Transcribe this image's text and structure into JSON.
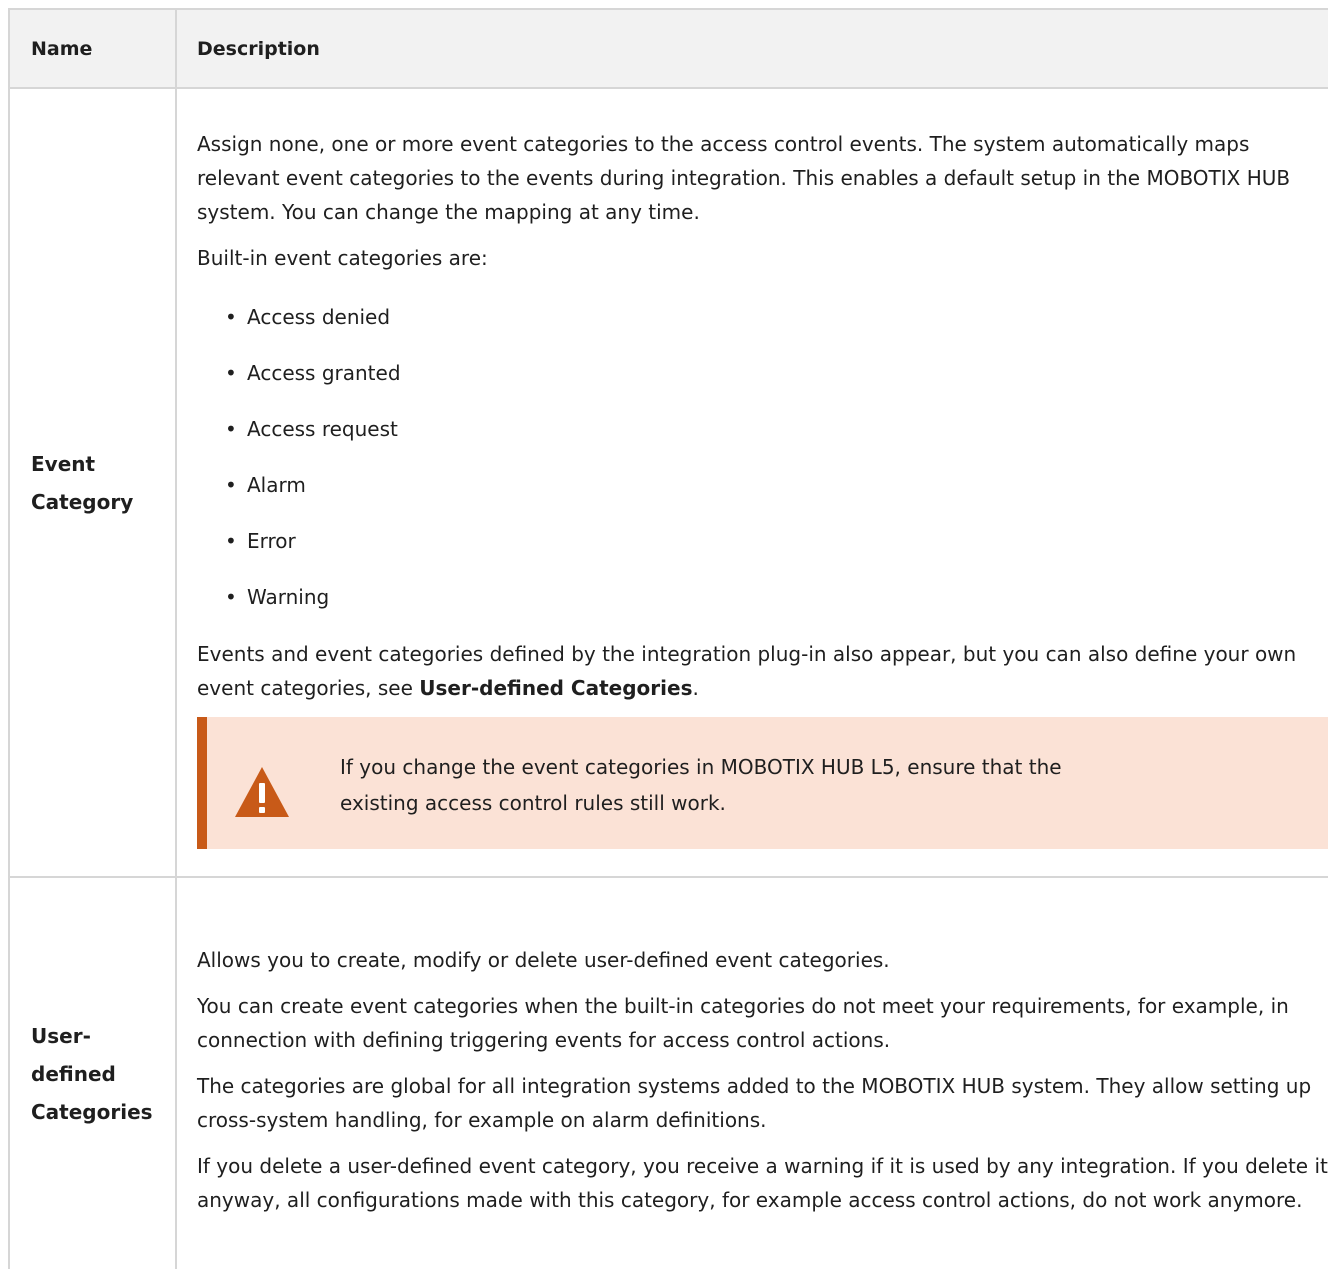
{
  "table": {
    "headers": {
      "name": "Name",
      "description": "Description"
    },
    "event_category": {
      "name_line1": "Event",
      "name_line2": "Category",
      "intro": "Assign none, one or more event categories to the access control events. The system automatically maps relevant event categories to the events during integration. This enables a default setup in the MOBOTIX HUB system. You can change the mapping at any time.",
      "builtin_intro": "Built-in event categories are:",
      "builtin_items": [
        "Access denied",
        "Access granted",
        "Access request",
        "Alarm",
        "Error",
        "Warning"
      ],
      "followup_text": "Events and event categories defined by the integration plug-in also appear, but you can also define your own event categories, see ",
      "followup_link": "User-defined Categories",
      "followup_end": ".",
      "warning": {
        "icon": "warning-triangle-icon",
        "line1": "If you change the event categories in MOBOTIX HUB L5, ensure that the",
        "line2": "existing access control rules still work."
      }
    },
    "user_defined": {
      "name_line1": "User-",
      "name_line2": "defined",
      "name_line3": "Categories",
      "p1": "Allows you to create, modify or delete user-defined event categories.",
      "p2": "You can create event categories when the built-in categories do not meet your requirements, for example, in connection with defining triggering events for access control actions.",
      "p3": "The categories are global for all integration systems added to the MOBOTIX HUB system. They allow setting up cross-system handling, for example on alarm definitions.",
      "p4": "If you delete a user-defined event category, you receive a warning if it is used by any integration. If you delete it anyway, all configurations made with this category, for example access control actions, do not work anymore."
    }
  },
  "colors": {
    "header_bg": "#f2f2f2",
    "border": "#d6d6d6",
    "warning_bg": "#fbe2d6",
    "warning_accent": "#c85a18"
  }
}
